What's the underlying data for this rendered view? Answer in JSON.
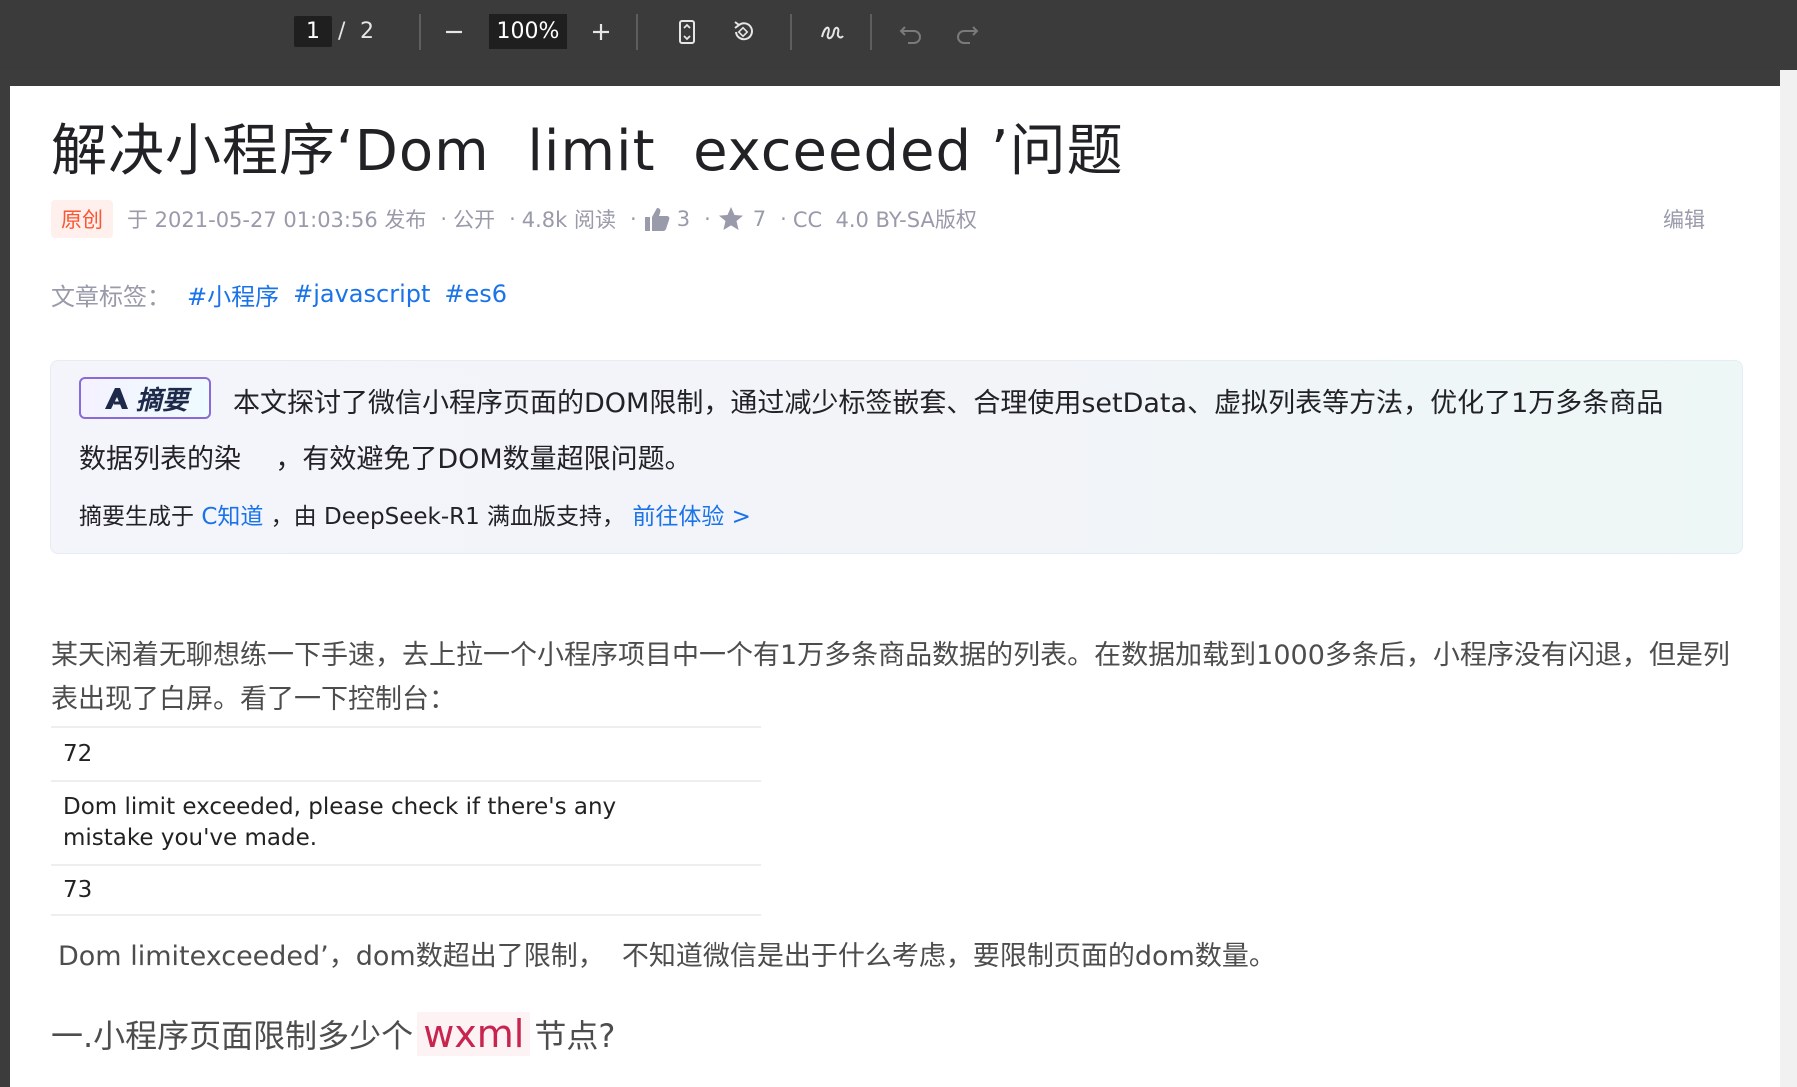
{
  "toolbar": {
    "page_current": "1",
    "page_separator": "/",
    "page_total": "2",
    "zoom": "100%"
  },
  "article": {
    "title": "解决小程序‘Dom  limit  exceeded ’问题",
    "badge": "原创",
    "publish": "于 2021-05-27 01:03:56 发布",
    "visibility": "公开",
    "reads": "4.8k 阅读",
    "likes": "3",
    "favorites": "7",
    "license": "CC  4.0 BY-SA版权",
    "edit": "编辑",
    "tags_label": "文章标签：",
    "tags": [
      "#小程序",
      "#javascript",
      "#es6"
    ],
    "summary": {
      "badge": "摘要",
      "line1": "本文探讨了微信小程序页面的DOM限制，通过减少标签嵌套、合理使用setData、虚拟列表等方法，优化了1万多条商品",
      "line2": "数据列表的染    ，有效避免了DOM数量超限问题。",
      "gen_prefix": "摘要生成于 ",
      "gen_link": "C知道",
      "gen_mid": " ，由 DeepSeek-R1 满血版支持， ",
      "gen_try": "前往体验 >"
    },
    "para1": "某天闲着无聊想练一下手速，去上拉一个小程序项目中一个有1万多条商品数据的列表。在数据加载到1000多条后，小程序没有闪退，但是列表出现了白屏。看了一下控制台：",
    "console": {
      "num1": "72",
      "msg_line1": "Dom limit exceeded, please check if there's any",
      "msg_line2": "mistake you've made.",
      "num2": "73"
    },
    "para2": "Dom limitexceeded’，dom数超出了限制，  不知道微信是出于什么考虑，要限制页面的dom数量。",
    "h2_prefix": "一.小程序页面限制多少个",
    "h2_code": "wxml",
    "h2_suffix": "节点?"
  },
  "colors": {
    "toolbar_bg": "#3b3b3b",
    "link": "#1a73e8",
    "badge_orig": "#fc5531",
    "code_text": "#c7254e"
  },
  "icons": [
    "minus-icon",
    "plus-icon",
    "fit-page-icon",
    "rotate-icon",
    "draw-icon",
    "undo-icon",
    "redo-icon",
    "thumbs-up-icon",
    "star-icon"
  ]
}
